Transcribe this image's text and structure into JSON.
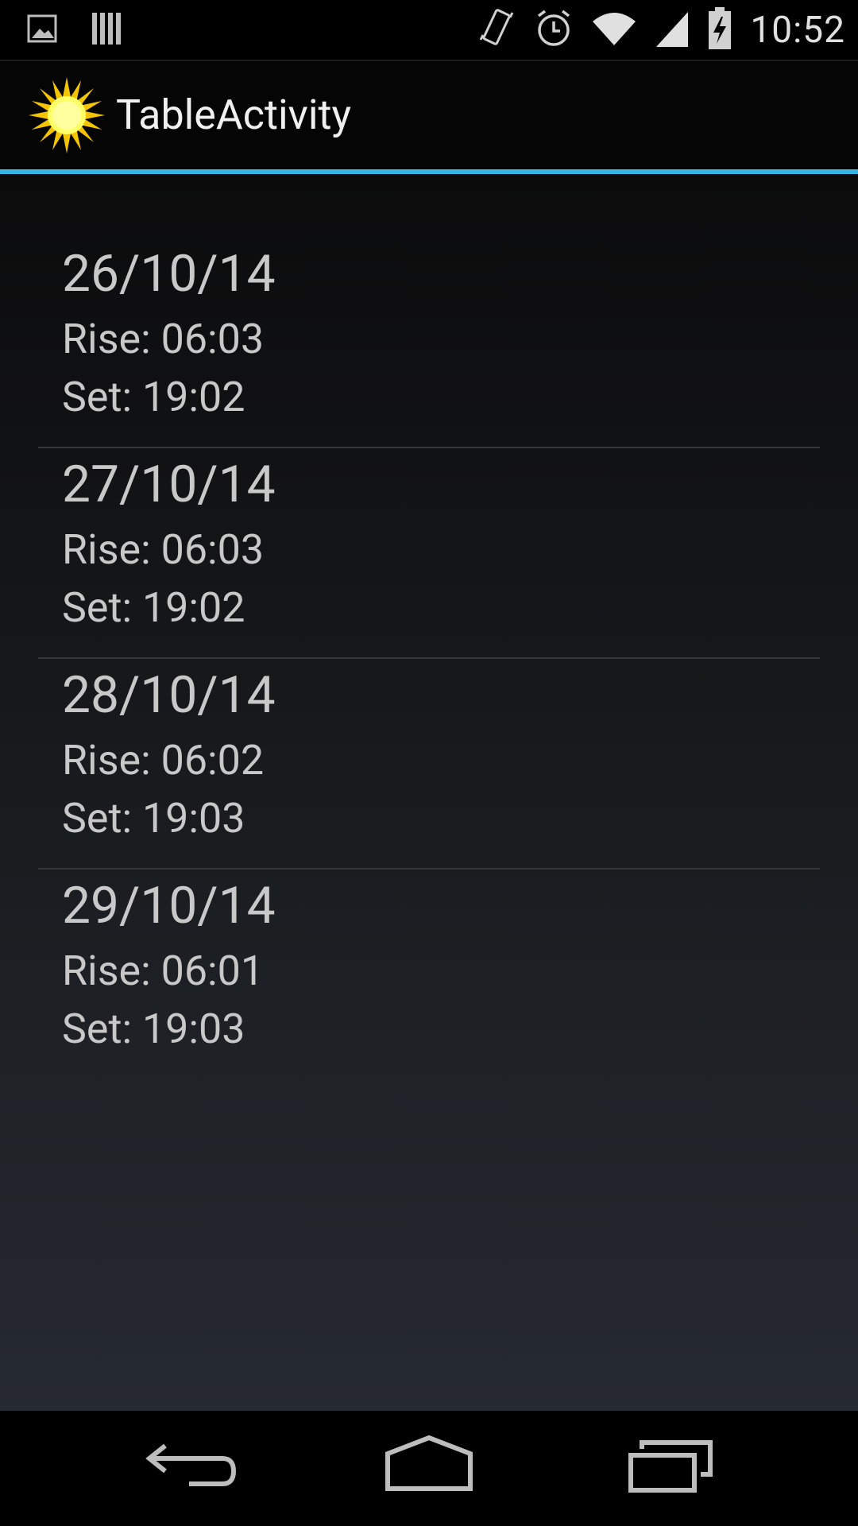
{
  "status_bar": {
    "time": "10:52",
    "left_icons": [
      "image-icon",
      "storage-icon"
    ],
    "right_icons": [
      "vibrate-icon",
      "alarm-icon",
      "wifi-icon",
      "signal-icon",
      "battery-charging-icon"
    ]
  },
  "action_bar": {
    "title": "TableActivity",
    "icon": "sun-icon"
  },
  "colors": {
    "accent": "#33b5e5",
    "text": "#c8c8c8"
  },
  "entries": [
    {
      "date": "26/10/14",
      "rise": "Rise:  06:03",
      "set": "Set:  19:02"
    },
    {
      "date": "27/10/14",
      "rise": "Rise:  06:03",
      "set": "Set:  19:02"
    },
    {
      "date": "28/10/14",
      "rise": "Rise:  06:02",
      "set": "Set:  19:03"
    },
    {
      "date": "29/10/14",
      "rise": "Rise:  06:01",
      "set": "Set:  19:03"
    }
  ],
  "nav_bar": {
    "icons": [
      "back-icon",
      "home-icon",
      "recent-apps-icon"
    ]
  }
}
